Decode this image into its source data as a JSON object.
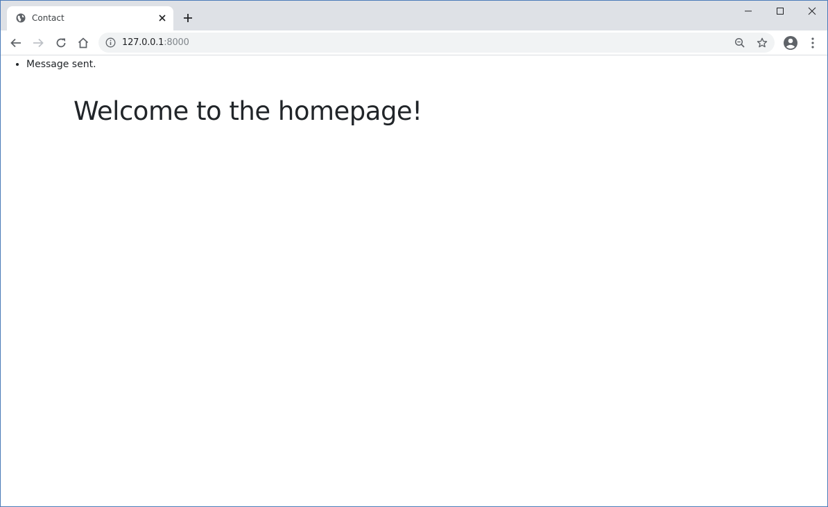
{
  "browser": {
    "tab": {
      "title": "Contact"
    },
    "address_bar": {
      "host": "127.0.0.1",
      "port": ":8000"
    },
    "icons": {
      "favicon": "globe-icon",
      "tab_close": "close-icon",
      "new_tab": "plus-icon",
      "back": "arrow-left-icon",
      "forward": "arrow-right-icon",
      "reload": "reload-icon",
      "home": "home-icon",
      "site_info": "info-icon",
      "zoom": "zoom-out-icon",
      "bookmark": "star-icon",
      "profile": "account-icon",
      "menu": "kebab-menu-icon",
      "minimize": "minimize-icon",
      "maximize": "maximize-icon",
      "close_window": "close-window-icon"
    },
    "colors": {
      "tabstrip": "#dee1e6",
      "omnibox": "#f1f3f4",
      "window_border": "#4a7ab8"
    }
  },
  "page": {
    "messages": [
      "Message sent."
    ],
    "title": "Welcome to the homepage!"
  }
}
